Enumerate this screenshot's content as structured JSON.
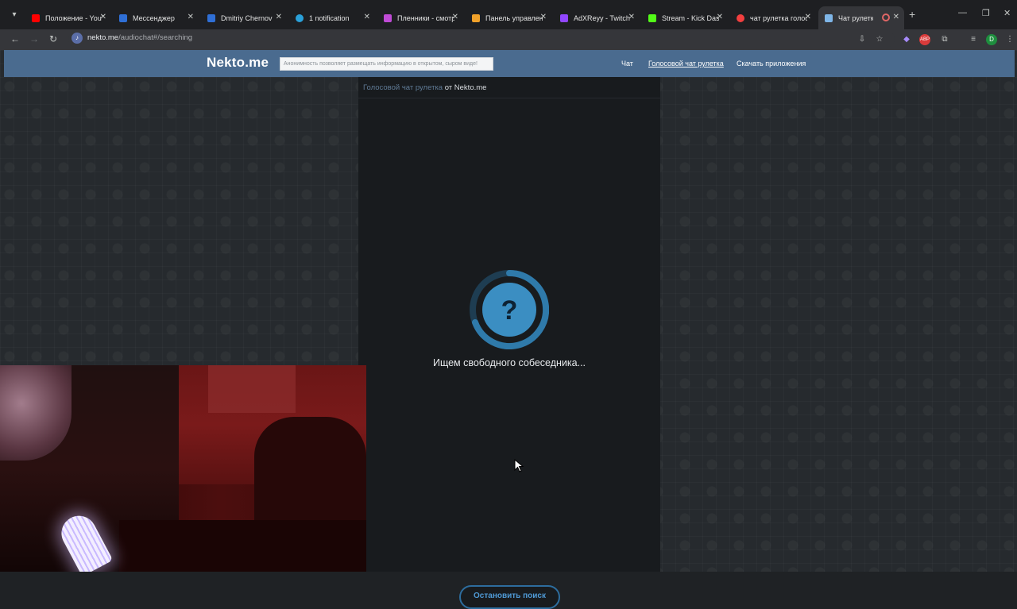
{
  "browser": {
    "tabs": [
      {
        "title": "Положение - YouTube",
        "fav_color": "#ff0000"
      },
      {
        "title": "Мессенджер",
        "fav_color": "#2f6fd6"
      },
      {
        "title": "Dmitriy Chernov",
        "fav_color": "#2f6fd6"
      },
      {
        "title": "1 notification",
        "fav_color": "#2aa1da"
      },
      {
        "title": "Пленники - смотреть",
        "fav_color": "#c04bd6"
      },
      {
        "title": "Панель управления",
        "fav_color": "#f0a12a"
      },
      {
        "title": "AdXReyy - Twitch",
        "fav_color": "#9146ff"
      },
      {
        "title": "Stream - Kick Dashboard",
        "fav_color": "#53fc18"
      },
      {
        "title": "чат рулетка голосовой",
        "fav_color": "#f33f3f"
      },
      {
        "title": "Чат рулетка",
        "fav_color": "#7fb6e8"
      }
    ],
    "active_tab_index": 9,
    "url_host": "nekto.me",
    "url_path": "/audiochat#/searching",
    "profile_initial": "D"
  },
  "site": {
    "logo": "Nekto.me",
    "slogan": "Анонимность позволяет размещать информацию в открытом, сыром виде!",
    "nav": [
      {
        "label": "Чат"
      },
      {
        "label": "Голосовой чат рулетка"
      },
      {
        "label": "Скачать приложения"
      }
    ],
    "breadcrumb_link": "Голосовой чат рулетка",
    "breadcrumb_from": "от Nekto.me"
  },
  "search": {
    "icon": "question-mark-icon",
    "status": "Ищем свободного собеседника...",
    "stop_button": "Остановить поиск"
  },
  "colors": {
    "header": "#4a6b8f",
    "panel": "#181b1e",
    "accent": "#2d6d9e"
  }
}
